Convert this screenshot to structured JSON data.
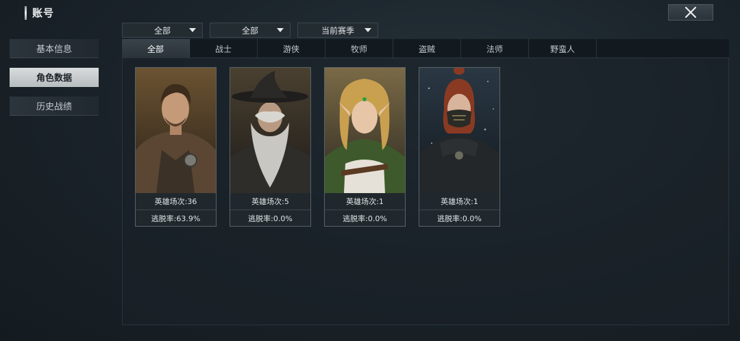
{
  "header": {
    "title": "账号",
    "close_icon": "close-icon"
  },
  "sidebar": {
    "items": [
      {
        "label": "基本信息",
        "active": false
      },
      {
        "label": "角色数据",
        "active": true
      },
      {
        "label": "历史战绩",
        "active": false
      }
    ]
  },
  "filters": [
    {
      "selected": "全部"
    },
    {
      "selected": "全部"
    },
    {
      "selected": "当前赛季"
    }
  ],
  "tabs": [
    {
      "label": "全部",
      "active": true
    },
    {
      "label": "战士",
      "active": false
    },
    {
      "label": "游侠",
      "active": false
    },
    {
      "label": "牧师",
      "active": false
    },
    {
      "label": "盗贼",
      "active": false
    },
    {
      "label": "法师",
      "active": false
    },
    {
      "label": "野蛮人",
      "active": false
    }
  ],
  "cards": [
    {
      "portrait": "warrior-portrait",
      "matches": "英雄场次:36",
      "escape": "逃脱率:63.9%"
    },
    {
      "portrait": "wizard-portrait",
      "matches": "英雄场次:5",
      "escape": "逃脱率:0.0%"
    },
    {
      "portrait": "elf-portrait",
      "matches": "英雄场次:1",
      "escape": "逃脱率:0.0%"
    },
    {
      "portrait": "rogue-portrait",
      "matches": "英雄场次:1",
      "escape": "逃脱率:0.0%"
    }
  ],
  "colors": {
    "active_tab": "#39434a",
    "active_side": "#d9dcdd",
    "card_border": "#5a6368"
  }
}
